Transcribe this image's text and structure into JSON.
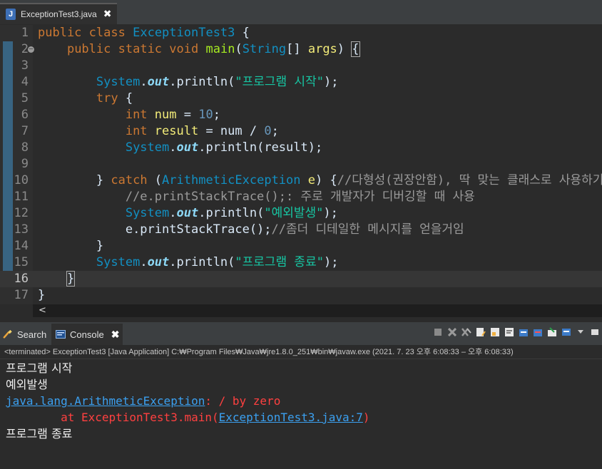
{
  "editor_tab": {
    "icon": "J",
    "filename": "ExceptionTest3.java",
    "close": "✖"
  },
  "code_lines": [
    {
      "n": "1"
    },
    {
      "n": "2"
    },
    {
      "n": "3"
    },
    {
      "n": "4"
    },
    {
      "n": "5"
    },
    {
      "n": "6"
    },
    {
      "n": "7"
    },
    {
      "n": "8"
    },
    {
      "n": "9"
    },
    {
      "n": "10"
    },
    {
      "n": "11"
    },
    {
      "n": "12"
    },
    {
      "n": "13"
    },
    {
      "n": "14"
    },
    {
      "n": "15"
    },
    {
      "n": "16"
    },
    {
      "n": "17"
    }
  ],
  "code": {
    "l1": {
      "k1": "public",
      "k2": "class",
      "name": "ExceptionTest3",
      "brace": " {"
    },
    "l2": {
      "k1": "public",
      "k2": "static",
      "k3": "void",
      "fn": "main",
      "p1": "(",
      "type": "String",
      "p2": "[] ",
      "arg": "args",
      "p3": ") ",
      "brace": "{"
    },
    "l4": {
      "cls": "System",
      "dot1": ".",
      "field": "out",
      "call": ".println(",
      "str": "\"프로그램 시작\"",
      "end": ");"
    },
    "l5": {
      "kw": "try",
      "brace": " {"
    },
    "l6": {
      "type": "int",
      "var": "num",
      "op": " = ",
      "num": "10",
      "end": ";"
    },
    "l7": {
      "type": "int",
      "var": "result",
      "op": " = num / ",
      "num": "0",
      "end": ";"
    },
    "l8": {
      "cls": "System",
      "dot1": ".",
      "field": "out",
      "call": ".println(result);"
    },
    "l10": {
      "close": "} ",
      "kw": "catch",
      "p1": " (",
      "type": "ArithmeticException",
      "var": " e",
      "p2": ") {",
      "comment": "//다형성(권장안함), 딱 맞는 클래스로 사용하기"
    },
    "l11": {
      "comment": "//e.printStackTrace();: 주로 개발자가 디버깅할 때 사용"
    },
    "l12": {
      "cls": "System",
      "dot1": ".",
      "field": "out",
      "call": ".println(",
      "str": "\"예외발생\"",
      "end": ");"
    },
    "l13": {
      "code": "e.printStackTrace();",
      "comment": "//좀더 디테일한 메시지를 얻을거임"
    },
    "l14": {
      "brace": "}"
    },
    "l15": {
      "cls": "System",
      "dot1": ".",
      "field": "out",
      "call": ".println(",
      "str": "\"프로그램 종료\"",
      "end": ");"
    },
    "l16": {
      "brace": "}"
    },
    "l17": {
      "brace": "}"
    }
  },
  "hscroll_arrow": "<",
  "panel": {
    "search_label": "Search",
    "console_label": "Console",
    "console_close": "✖"
  },
  "console": {
    "status": "<terminated> ExceptionTest3 [Java Application] C:₩Program Files₩Java₩jre1.8.0_251₩bin₩javaw.exe  (2021. 7. 23 오후 6:08:33 – 오후 6:08:33)",
    "line1": "프로그램 시작",
    "line2": "예외발생",
    "exc_class": "java.lang.ArithmeticException",
    "exc_msg": ": / by zero",
    "at_prefix": "        at ExceptionTest3.main(",
    "at_link": "ExceptionTest3.java:7",
    "at_suffix": ")",
    "line5": "프로그램 종료"
  },
  "colors": {
    "background": "#2b2b2b",
    "keyword": "#cc7832",
    "string": "#17c6a3",
    "error": "#ff4040",
    "link": "#3ba0f0"
  }
}
